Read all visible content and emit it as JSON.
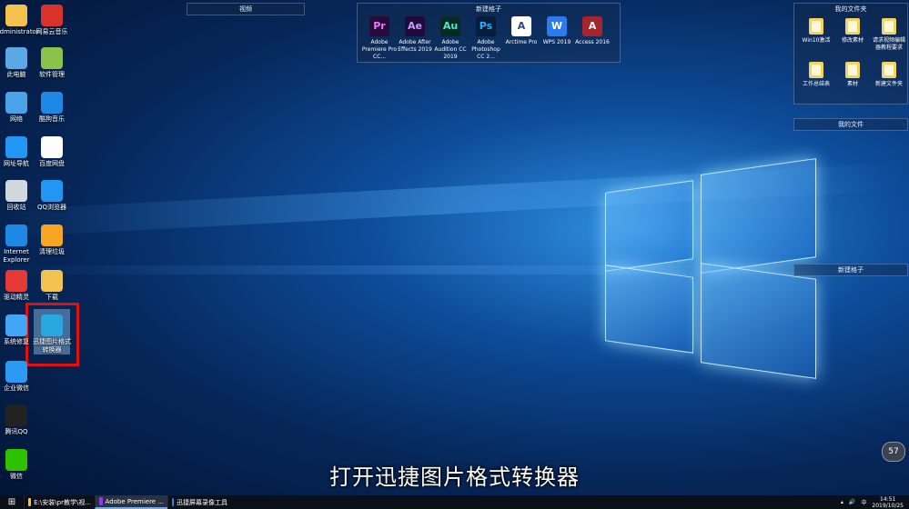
{
  "desktop_icons": [
    {
      "label": "Administrator",
      "icon": "user-folder-icon",
      "color": "#f2c14e"
    },
    {
      "label": "网易云音乐",
      "icon": "netease-music-icon",
      "color": "#d8322a"
    },
    {
      "label": "此电脑",
      "icon": "computer-icon",
      "color": "#5aa9e6"
    },
    {
      "label": "软件管理",
      "icon": "software-manager-icon",
      "color": "#8bc34a"
    },
    {
      "label": "网络",
      "icon": "network-icon",
      "color": "#4aa3e8"
    },
    {
      "label": "酷狗音乐",
      "icon": "kugou-music-icon",
      "color": "#1e88e5"
    },
    {
      "label": "网址导航",
      "icon": "ie-nav-icon",
      "color": "#2196f3"
    },
    {
      "label": "百度网盘",
      "icon": "baidu-pan-icon",
      "color": "#ffffff"
    },
    {
      "label": "回收站",
      "icon": "recycle-bin-icon",
      "color": "#cfd8dc"
    },
    {
      "label": "QQ浏览器",
      "icon": "qq-browser-icon",
      "color": "#2196f3"
    },
    {
      "label": "Internet Explorer",
      "icon": "internet-explorer-icon",
      "color": "#1e88e5"
    },
    {
      "label": "清理垃圾",
      "icon": "clean-trash-icon",
      "color": "#f6a623"
    },
    {
      "label": "驱动精灵",
      "icon": "driver-genius-icon",
      "color": "#e53935"
    },
    {
      "label": "下载",
      "icon": "download-folder-icon",
      "color": "#f2c14e"
    },
    {
      "label": "系统修复",
      "icon": "system-repair-icon",
      "color": "#42a5f5"
    },
    {
      "label": "迅捷图片格式转换器",
      "icon": "image-converter-icon",
      "color": "#29a8e0"
    },
    {
      "label": "企业微信",
      "icon": "wecom-icon",
      "color": "#2b9af3"
    },
    {
      "label": "腾讯QQ",
      "icon": "qq-icon",
      "color": "#222222"
    },
    {
      "label": "微信",
      "icon": "wechat-icon",
      "color": "#2dc100"
    }
  ],
  "fence_shipin": {
    "title": "视频"
  },
  "fence_new": {
    "title": "新建格子",
    "apps": [
      {
        "label": "Adobe Premiere Pro CC...",
        "abbr": "Pr",
        "color": "#2a0a3a",
        "fg": "#e77cff"
      },
      {
        "label": "Adobe After Effects 2019",
        "abbr": "Ae",
        "color": "#1f0a3a",
        "fg": "#c79cff"
      },
      {
        "label": "Adobe Audition CC 2019",
        "abbr": "Au",
        "color": "#062a24",
        "fg": "#4fe8c6"
      },
      {
        "label": "Adobe Photoshop CC 2...",
        "abbr": "Ps",
        "color": "#061e3a",
        "fg": "#31a8ff"
      },
      {
        "label": "Arctime Pro",
        "abbr": "A",
        "color": "#ffffff",
        "fg": "#2b4a7a"
      },
      {
        "label": "WPS 2019",
        "abbr": "W",
        "color": "#2b7bef",
        "fg": "#ffffff"
      },
      {
        "label": "Access 2016",
        "abbr": "A",
        "color": "#a4262c",
        "fg": "#ffffff"
      }
    ]
  },
  "fence_my_folders": {
    "title": "我的文件夹",
    "items": [
      "Win10激活",
      "修改素材",
      "请求视频编辑器教程要求",
      "工作总结表",
      "素材",
      "新建文件夹"
    ]
  },
  "fence_my_files": {
    "title": "我的文件"
  },
  "fence_new2": {
    "title": "新建格子"
  },
  "subtitle": "打开迅捷图片格式转换器",
  "badge": "57",
  "taskbar": {
    "items": [
      {
        "label": "E:\\安装\\pr教学\\视...",
        "color": "#f2c14e"
      },
      {
        "label": "Adobe Premiere ...",
        "color": "#9b30ff"
      },
      {
        "label": "迅捷屏幕录像工具",
        "color": "#1e88e5"
      }
    ],
    "ime": "中",
    "time": "14:51",
    "date": "2019/10/25"
  }
}
